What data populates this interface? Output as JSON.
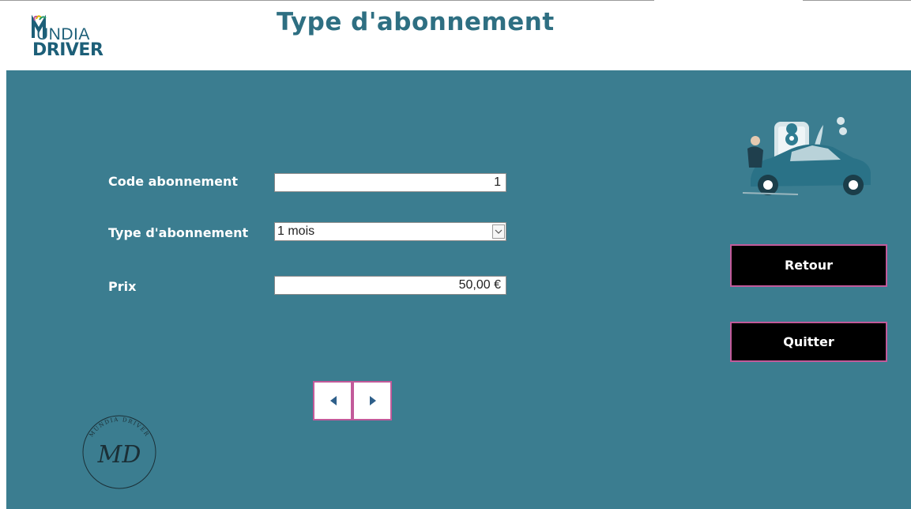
{
  "header": {
    "title": "Type d'abonnement",
    "logo": {
      "word1": "UNDIA",
      "word2": "DRIVER"
    }
  },
  "form": {
    "code_label": "Code abonnement",
    "code_value": "1",
    "type_label": "Type d'abonnement",
    "type_value": "1 mois",
    "prix_label": "Prix",
    "prix_value": "50,00 €"
  },
  "actions": {
    "retour_label": "Retour",
    "quitter_label": "Quitter"
  },
  "seal": {
    "initials": "MD",
    "ring_text": "MUNDIA DRIVER"
  },
  "colors": {
    "panel": "#3b7d90",
    "title": "#2e6f82",
    "button_border": "#c25a9a"
  }
}
